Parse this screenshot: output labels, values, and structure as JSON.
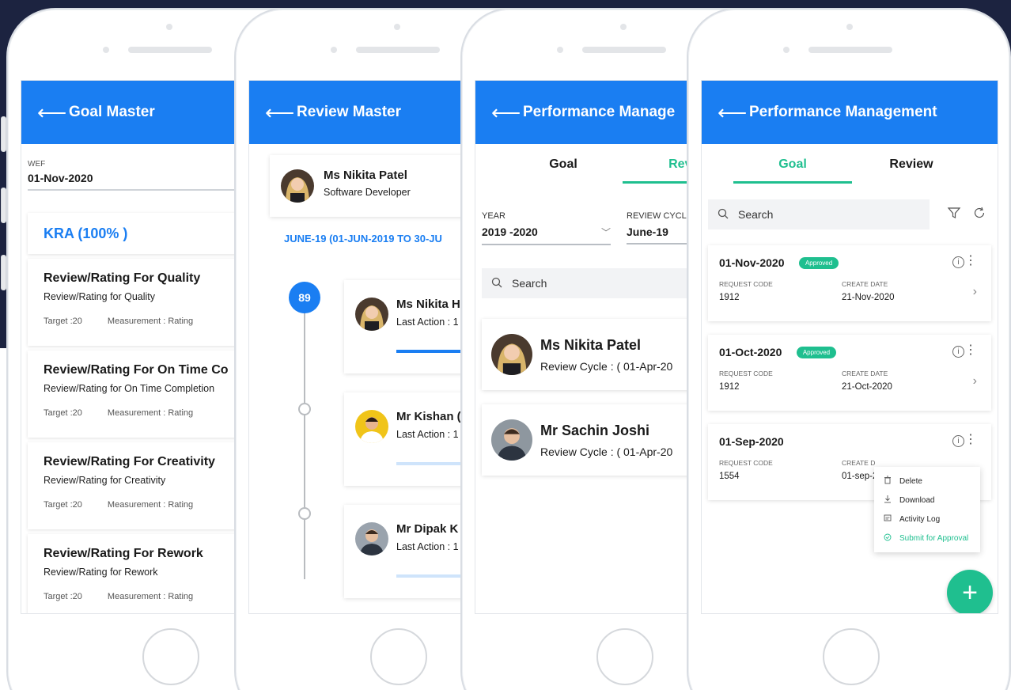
{
  "colors": {
    "primary": "#1a7ef2",
    "accent": "#1fbf8f",
    "background_dark": "#1c2340"
  },
  "goal_master": {
    "title": "Goal Master",
    "wef_label": "WEF",
    "wef_value": "01-Nov-2020",
    "kra_title": "KRA (100% )",
    "items": [
      {
        "title": "Review/Rating For Quality",
        "desc": "Review/Rating for Quality",
        "target": "Target :20",
        "measurement": "Measurement : Rating"
      },
      {
        "title": "Review/Rating For On Time Co",
        "desc": "Review/Rating for On Time Completion",
        "target": "Target :20",
        "measurement": "Measurement : Rating"
      },
      {
        "title": "Review/Rating For Creativity",
        "desc": "Review/Rating for Creativity",
        "target": "Target :20",
        "measurement": "Measurement : Rating"
      },
      {
        "title": "Review/Rating For Rework",
        "desc": "Review/Rating for Rework",
        "target": "Target :20",
        "measurement": "Measurement : Rating"
      }
    ]
  },
  "review_master": {
    "title": "Review Master",
    "profile_name": "Ms Nikita Patel",
    "profile_role": "Software Developer",
    "cycle_label": "JUNE-19 (01-JUN-2019 TO 30-JU",
    "timeline_badge": "89",
    "reviews": [
      {
        "name": "Ms Nikita H",
        "last_action": "Last Action : 1",
        "progress": 0.5
      },
      {
        "name": "Mr Kishan (",
        "last_action": "Last Action : 1",
        "progress": 0
      },
      {
        "name": "Mr Dipak K",
        "last_action": "Last Action : 1",
        "progress": 0
      }
    ]
  },
  "performance_review": {
    "title": "Performance Manage",
    "tab_goal": "Goal",
    "tab_review": "Revi",
    "year_label": "YEAR",
    "year_value": "2019 -2020",
    "cycle_label": "REVIEW CYCL",
    "cycle_value": "June-19",
    "search_placeholder": "Search",
    "employees": [
      {
        "name": "Ms Nikita Patel",
        "cycle": "Review Cycle : ( 01-Apr-20"
      },
      {
        "name": "Mr Sachin Joshi",
        "cycle": "Review Cycle : ( 01-Apr-20"
      }
    ]
  },
  "performance_goal": {
    "title": "Performance Management",
    "tab_goal": "Goal",
    "tab_review": "Review",
    "search_placeholder": "Search",
    "request_code_label": "REQUEST CODE",
    "create_date_label": "CREATE DATE",
    "requests": [
      {
        "date": "01-Nov-2020",
        "status": "Approved",
        "code": "1912",
        "create_date": "21-Nov-2020"
      },
      {
        "date": "01-Oct-2020",
        "status": "Approved",
        "code": "1912",
        "create_date": "21-Oct-2020"
      },
      {
        "date": "01-Sep-2020",
        "status": "",
        "code": "1554",
        "create_date_label": "CREATE D",
        "create_date": "01-sep-2"
      }
    ],
    "menu": {
      "delete": "Delete",
      "download": "Download",
      "activity_log": "Activity Log",
      "submit": "Submit for Approval"
    },
    "fab_label": "+"
  },
  "icons": [
    "back-arrow-icon",
    "search-icon",
    "filter-icon",
    "refresh-icon",
    "info-icon",
    "more-vertical-icon",
    "chevron-right-icon",
    "chevron-down-icon",
    "trash-icon",
    "download-icon",
    "log-icon",
    "check-circle-icon",
    "plus-icon"
  ]
}
